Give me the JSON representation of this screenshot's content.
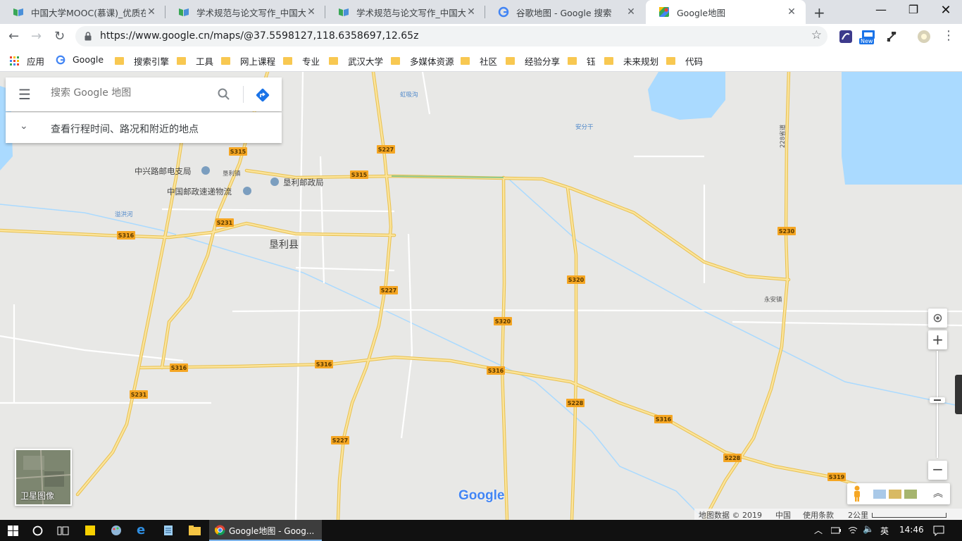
{
  "tabs": [
    {
      "title": "中国大学MOOC(慕课)_优质在"
    },
    {
      "title": "学术规范与论文写作_中国大学"
    },
    {
      "title": "学术规范与论文写作_中国大学"
    },
    {
      "title": "谷歌地图 - Google 搜索"
    },
    {
      "title": "Google地图"
    }
  ],
  "address": {
    "url": "https://www.google.cn/maps/@37.5598127,118.6358697,12.65z"
  },
  "extensions": {
    "new_badge": "New"
  },
  "bookmarks": {
    "apps": "应用",
    "google": "Google",
    "items": [
      "搜索引擎",
      "工具",
      "网上课程",
      "专业",
      "武汉大学",
      "多媒体资源",
      "社区",
      "经验分享",
      "钰",
      "未来规划",
      "代码"
    ]
  },
  "search": {
    "placeholder": "搜索 Google 地图",
    "travel_text": "查看行程时间、路况和附近的地点"
  },
  "map": {
    "town_main": "垦利县",
    "places": [
      "中兴路邮电支局",
      "垦利镇",
      "垦利邮政局",
      "中国邮政速递物流",
      "溢洪河",
      "虹吸沟",
      "安分干",
      "永安镇",
      "228省道"
    ],
    "roads": [
      "S315",
      "S315",
      "S227",
      "S227",
      "S227",
      "S231",
      "S231",
      "S316",
      "S316",
      "S316",
      "S316",
      "S316",
      "S230",
      "S320",
      "S320",
      "S228",
      "S228",
      "S319"
    ],
    "satellite_label": "卫星图像",
    "logo": "Google",
    "footer": {
      "data": "地图数据 © 2019",
      "country": "中国",
      "terms": "使用条款",
      "scale": "2公里"
    }
  },
  "taskbar": {
    "active_window": "Google地图 - Goog...",
    "ime": "英",
    "time": "14:46"
  },
  "colors": {
    "tab_bar": "#dee1e6",
    "taskbar": "#111111",
    "road_yellow": "#f6d46a",
    "water": "#aadaff",
    "map_bg": "#e8e8e6"
  }
}
